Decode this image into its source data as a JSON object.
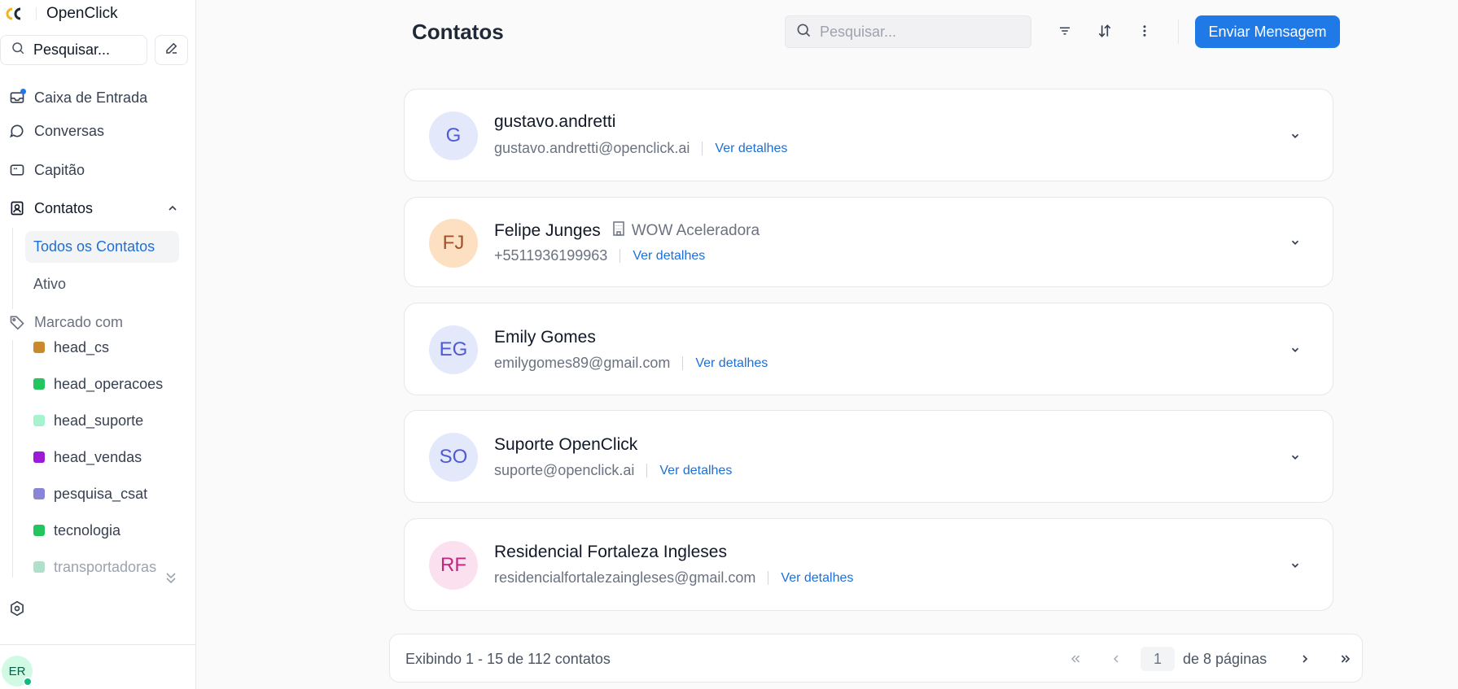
{
  "app": {
    "name": "OpenClick"
  },
  "sidebar": {
    "search_label": "Pesquisar...",
    "nav": {
      "inbox": "Caixa de Entrada",
      "conversations": "Conversas",
      "captain": "Capitão",
      "contacts": "Contatos"
    },
    "contacts_sub": {
      "all": "Todos os Contatos",
      "active": "Ativo"
    },
    "tags_section": "Marcado com",
    "tags": [
      {
        "label": "head_cs",
        "color": "#c98a2c"
      },
      {
        "label": "head_operacoes",
        "color": "#22c55e"
      },
      {
        "label": "head_suporte",
        "color": "#a7f3d0"
      },
      {
        "label": "head_vendas",
        "color": "#9b1bd6"
      },
      {
        "label": "pesquisa_csat",
        "color": "#8b84d7"
      },
      {
        "label": "tecnologia",
        "color": "#22c55e"
      },
      {
        "label": "transportadoras",
        "color": "#7ccaa9"
      }
    ],
    "settings": "Configurações",
    "user_initials": "ER"
  },
  "header": {
    "title": "Contatos",
    "search_placeholder": "Pesquisar...",
    "send_button": "Enviar Mensagem"
  },
  "contacts": [
    {
      "initials": "G",
      "name": "gustavo.andretti",
      "company": "",
      "contact": "gustavo.andretti@openclick.ai",
      "details_label": "Ver detalhes",
      "avatar_bg": "#e3e8fb",
      "avatar_fg": "#4f5bd5"
    },
    {
      "initials": "FJ",
      "name": "Felipe Junges",
      "company": "WOW Aceleradora",
      "contact": "+5511936199963",
      "details_label": "Ver detalhes",
      "avatar_bg": "#fde0c2",
      "avatar_fg": "#a0522d"
    },
    {
      "initials": "EG",
      "name": "Emily Gomes",
      "company": "",
      "contact": "emilygomes89@gmail.com",
      "details_label": "Ver detalhes",
      "avatar_bg": "#e3e8fb",
      "avatar_fg": "#4f5bd5"
    },
    {
      "initials": "SO",
      "name": "Suporte OpenClick",
      "company": "",
      "contact": "suporte@openclick.ai",
      "details_label": "Ver detalhes",
      "avatar_bg": "#e3e8fb",
      "avatar_fg": "#4f5bd5"
    },
    {
      "initials": "RF",
      "name": "Residencial Fortaleza Ingleses",
      "company": "",
      "contact": "residencialfortalezaingleses@gmail.com",
      "details_label": "Ver detalhes",
      "avatar_bg": "#fbe0ef",
      "avatar_fg": "#c0267a"
    }
  ],
  "pagination": {
    "summary": "Exibindo 1 - 15 de 112 contatos",
    "current_page": "1",
    "total_label": "de 8 páginas"
  },
  "colors": {
    "accent": "#1f7ae8",
    "link": "#1d6fd6"
  }
}
